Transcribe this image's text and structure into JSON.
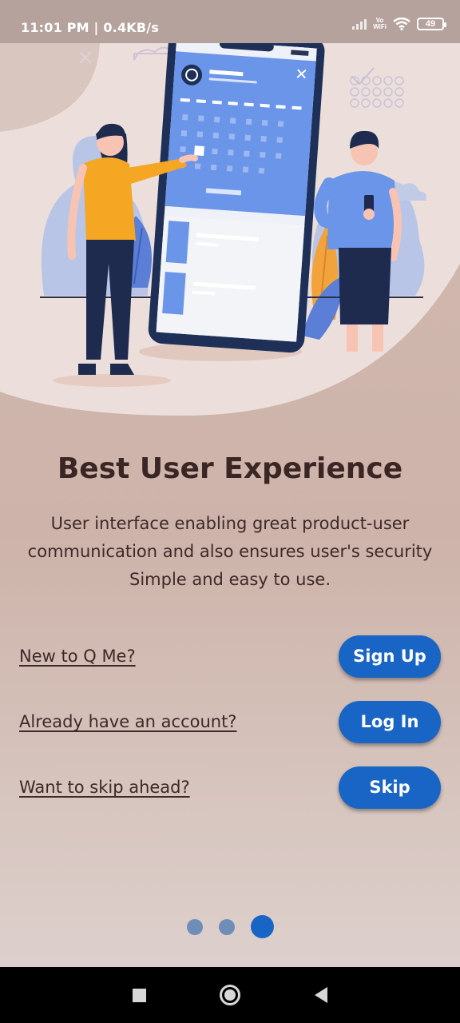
{
  "status_bar": {
    "time": "11:01 PM | 0.4KB/s",
    "vowifi_top": "Vo",
    "vowifi_bottom": "WiFi",
    "battery": "49"
  },
  "onboarding": {
    "title": "Best User Experience",
    "description": "User interface enabling great product-user communication and also ensures user's security Simple and easy to use."
  },
  "actions": [
    {
      "prompt": "New to Q Me?",
      "button": "Sign Up"
    },
    {
      "prompt": "Already have an account?",
      "button": "Log In"
    },
    {
      "prompt": "Want to skip ahead?",
      "button": "Skip"
    }
  ],
  "pager": {
    "total": 3,
    "active_index": 2
  },
  "colors": {
    "primary": "#1865c5",
    "background": "#d2b8ad",
    "text": "#3a2624",
    "dot_inactive": "#6f8db8"
  },
  "nav_bar": {
    "icons": [
      "recents-square-icon",
      "home-circle-icon",
      "back-triangle-icon"
    ]
  }
}
